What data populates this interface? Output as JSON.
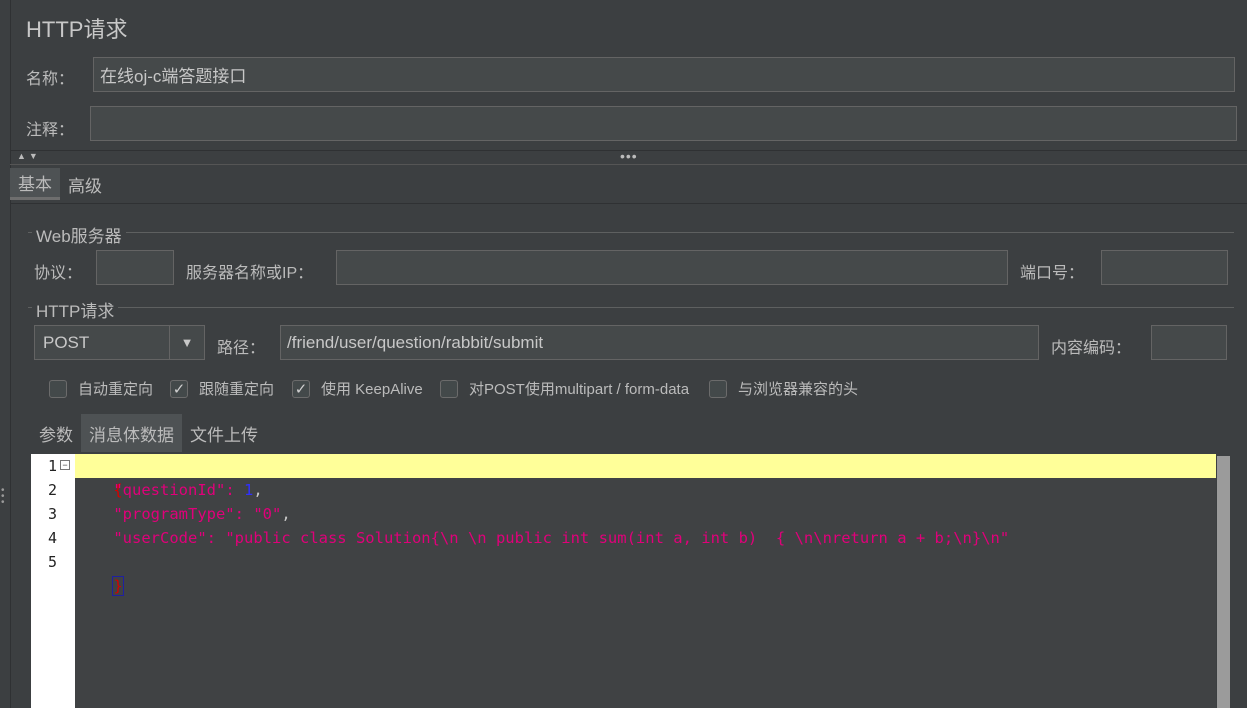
{
  "panel": {
    "title": "HTTP请求",
    "name_label": "名称：",
    "name_value": "在线oj-c端答题接口",
    "comment_label": "注释：",
    "comment_value": ""
  },
  "tabs_top": [
    {
      "label": "基本",
      "active": true
    },
    {
      "label": "高级",
      "active": false
    }
  ],
  "web_server": {
    "legend": "Web服务器",
    "protocol_label": "协议：",
    "protocol_value": "",
    "server_label": "服务器名称或IP：",
    "server_value": "",
    "port_label": "端口号：",
    "port_value": ""
  },
  "http_request": {
    "legend": "HTTP请求",
    "method": "POST",
    "path_label": "路径：",
    "path_value": "/friend/user/question/rabbit/submit",
    "encoding_label": "内容编码：",
    "encoding_value": ""
  },
  "options": [
    {
      "label": "自动重定向",
      "checked": false
    },
    {
      "label": "跟随重定向",
      "checked": true
    },
    {
      "label": "使用 KeepAlive",
      "checked": true
    },
    {
      "label": "对POST使用multipart / form-data",
      "checked": false
    },
    {
      "label": "与浏览器兼容的头",
      "checked": false
    }
  ],
  "body_tabs": [
    {
      "label": "参数",
      "active": false
    },
    {
      "label": "消息体数据",
      "active": true
    },
    {
      "label": "文件上传",
      "active": false
    }
  ],
  "editor": {
    "line_numbers": [
      "1",
      "2",
      "3",
      "4",
      "5"
    ],
    "line1": "{",
    "line2_key": "\"questionId\"",
    "line2_colon": ": ",
    "line2_val": "1",
    "line2_end": ",",
    "line3_key": "\"programType\"",
    "line3_colon": ": ",
    "line3_val": "\"0\"",
    "line3_end": ",",
    "line4_key": "\"userCode\"",
    "line4_colon": ": ",
    "line4_val": "\"public class Solution{\\n \\n public int sum(int a, int b)  { \\n\\nreturn a + b;\\n}\\n\"",
    "line5": "}"
  },
  "icons": {
    "dropdown": "chevron-down-icon",
    "check": "checkmark-icon",
    "fold": "fold-minus-icon",
    "split_arrows": "collapse-expand-arrows-icon",
    "split_dots": "drag-handle-dots-icon"
  }
}
